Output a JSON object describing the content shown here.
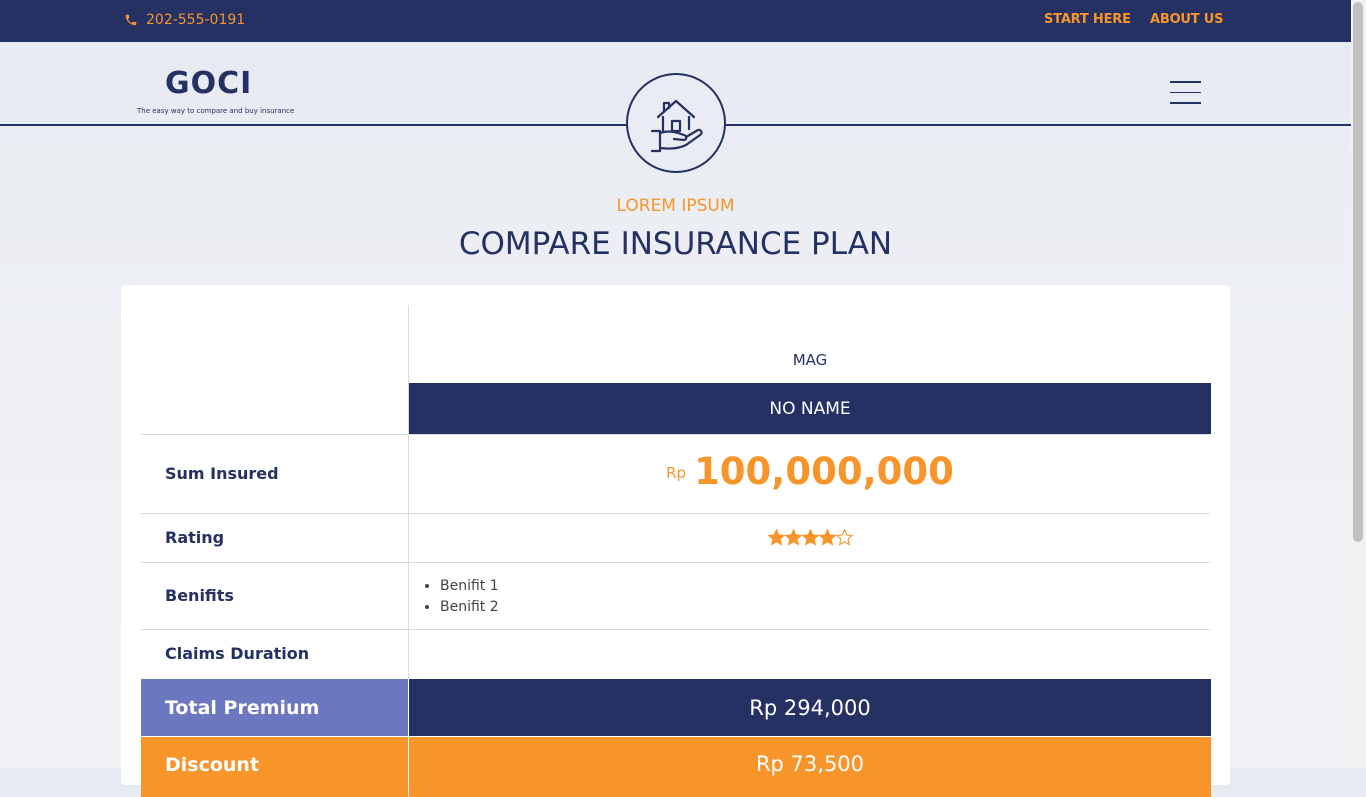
{
  "topbar": {
    "phone": "202-555-0191",
    "links": [
      "START HERE",
      "ABOUT US"
    ]
  },
  "logo": {
    "name": "GOCI",
    "tagline": "The easy way to compare and buy insurance"
  },
  "hero": {
    "eyebrow": "LOREM IPSUM",
    "title": "COMPARE INSURANCE PLAN"
  },
  "comparison": {
    "provider": "MAG",
    "plan_name": "NO NAME",
    "rows": {
      "sum_insured_label": "Sum Insured",
      "rating_label": "Rating",
      "benefits_label": "Benifits",
      "claims_label": "Claims Duration",
      "total_label": "Total Premium",
      "discount_label": "Discount"
    },
    "sum_insured_currency": "Rp",
    "sum_insured_amount": "100,000,000",
    "rating": 4,
    "rating_max": 5,
    "benefits": [
      "Benifit 1",
      "Benifit 2"
    ],
    "claims_duration": "",
    "total_premium": "Rp 294,000",
    "discount": "Rp 73,500"
  },
  "colors": {
    "navy": "#253063",
    "orange": "#f7952b",
    "periwinkle": "#6b78c0"
  },
  "icons": [
    "phone-icon",
    "house-in-hand-icon",
    "menu-icon",
    "star-icon"
  ]
}
